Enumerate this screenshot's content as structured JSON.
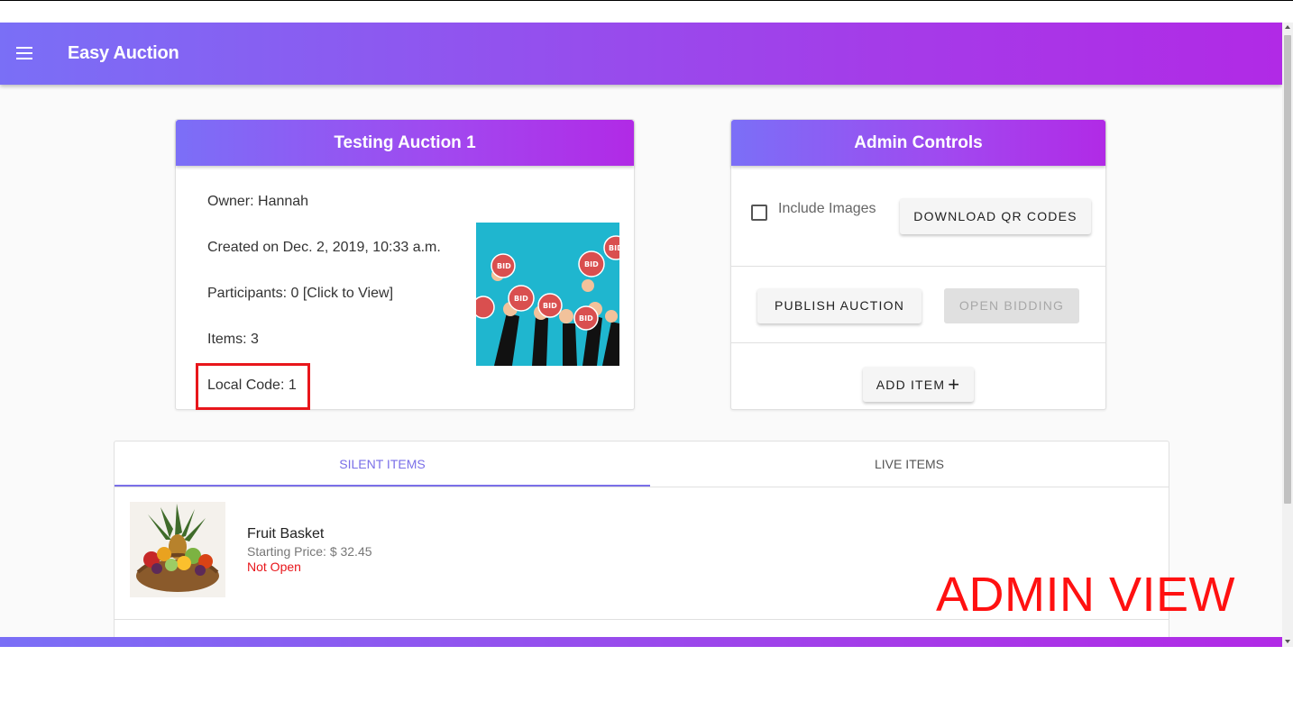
{
  "app": {
    "title": "Easy Auction",
    "menu_icon": "menu-icon"
  },
  "auction": {
    "title": "Testing Auction 1",
    "owner": "Owner: Hannah",
    "created": "Created on Dec. 2, 2019, 10:33 a.m.",
    "participants": "Participants: 0 [Click to View]",
    "items": "Items: 3",
    "local_code": "Local Code: 1"
  },
  "admin": {
    "title": "Admin Controls",
    "include_images_label": "Include Images",
    "include_images_checked": false,
    "download_qr_label": "DOWNLOAD QR CODES",
    "publish_label": "PUBLISH AUCTION",
    "open_bidding_label": "OPEN BIDDING",
    "open_bidding_disabled": true,
    "add_item_label": "ADD ITEM",
    "add_item_icon": "+"
  },
  "tabs": [
    {
      "label": "SILENT ITEMS",
      "active": true
    },
    {
      "label": "LIVE ITEMS",
      "active": false
    }
  ],
  "silent_items": [
    {
      "name": "Fruit Basket",
      "price": "Starting Price: $ 32.45",
      "status": "Not Open"
    }
  ],
  "annotation": {
    "text": "ADMIN VIEW",
    "color": "#ff1111"
  },
  "colors": {
    "accent_start": "#7a6ff6",
    "accent_end": "#b12ae6",
    "highlight_red": "#e8161b"
  }
}
